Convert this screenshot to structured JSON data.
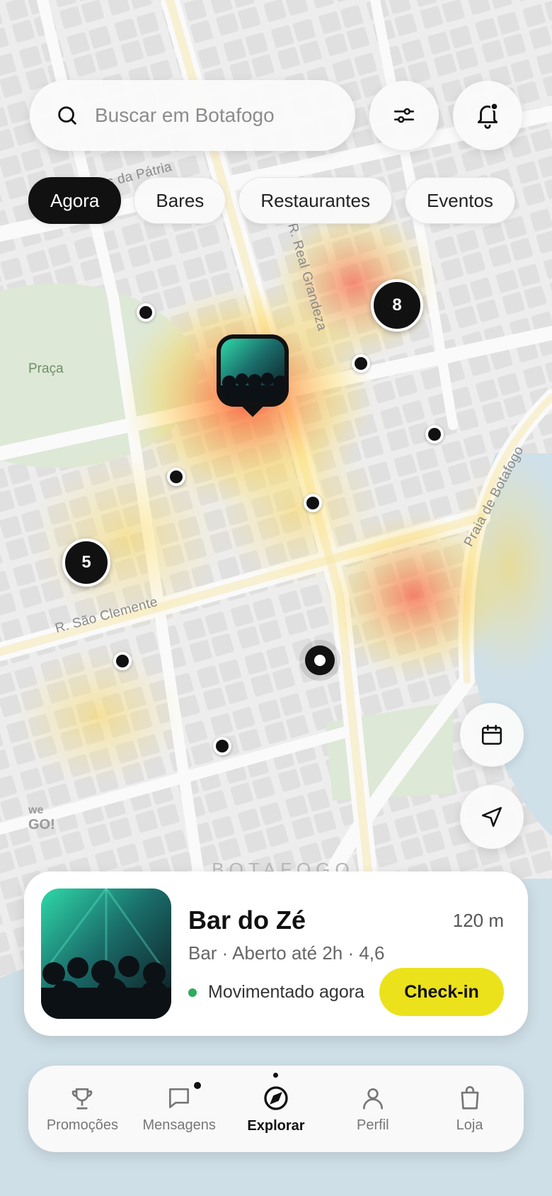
{
  "search": {
    "placeholder": "Buscar em Botafogo"
  },
  "filters": [
    "Agora",
    "Bares",
    "Restaurantes",
    "Eventos"
  ],
  "map": {
    "streets": [
      "s da Pátria",
      "R. Real Grandeza",
      "R. São Clemente",
      "Praia de Botafogo"
    ],
    "park": "Praça",
    "neighborhood": "BOTAFOGO",
    "clusters": [
      "8",
      "5"
    ],
    "logo_top": "we",
    "logo_bottom": "GO!"
  },
  "venue": {
    "name": "Bar do Zé",
    "distance": "120 m",
    "details": "Bar · Aberto até 2h · 4,6",
    "status": "Movimentado agora",
    "checkin": "Check-in"
  },
  "nav": [
    {
      "label": "Promoções",
      "icon": "trophy-icon"
    },
    {
      "label": "Mensagens",
      "icon": "chat-icon"
    },
    {
      "label": "Explorar",
      "icon": "compass-icon",
      "active": true
    },
    {
      "label": "Perfil",
      "icon": "user-icon"
    },
    {
      "label": "Loja",
      "icon": "bag-icon"
    }
  ],
  "colors": {
    "accent": "#EBE21B",
    "dark": "#111111",
    "online": "#2DAC5C"
  }
}
